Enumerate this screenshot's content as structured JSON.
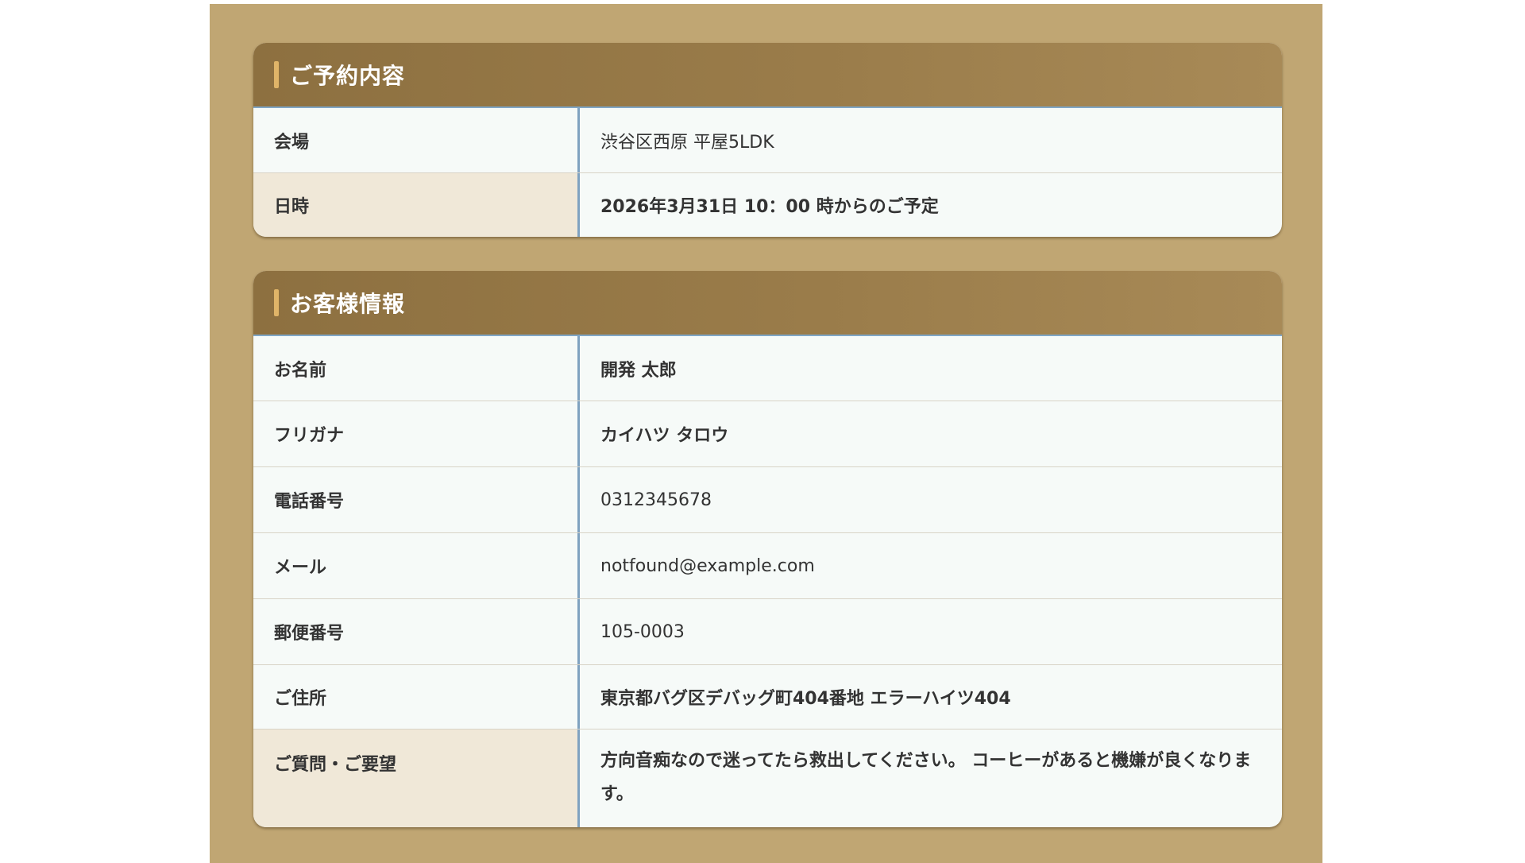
{
  "reservation": {
    "title": "ご予約内容",
    "rows": [
      {
        "label": "会場",
        "value": "渋谷区西原 平屋5LDK"
      },
      {
        "label": "日時",
        "value": "2026年3月31日 10：00 時からのご予定"
      }
    ]
  },
  "customer": {
    "title": "お客様情報",
    "rows": [
      {
        "label": "お名前",
        "value": "開発 太郎"
      },
      {
        "label": "フリガナ",
        "value": "カイハツ タロウ"
      },
      {
        "label": "電話番号",
        "value": "0312345678"
      },
      {
        "label": "メール",
        "value": "notfound@example.com"
      },
      {
        "label": "郵便番号",
        "value": "105-0003"
      },
      {
        "label": "ご住所",
        "value": "東京都バグ区デバッグ町404番地 エラーハイツ404"
      },
      {
        "label": "ご質問・ご要望",
        "value": "方向音痴なので迷ってたら救出してください。 コーヒーがあると機嫌が良くなります。"
      }
    ]
  },
  "colors": {
    "page_background": "#c0a673",
    "header_background": "#9a7c4a",
    "header_accent": "#e0b468",
    "label_highlight": "#f0e8d8",
    "cell_background": "#f6faf8",
    "divider": "#7fa2c0"
  }
}
